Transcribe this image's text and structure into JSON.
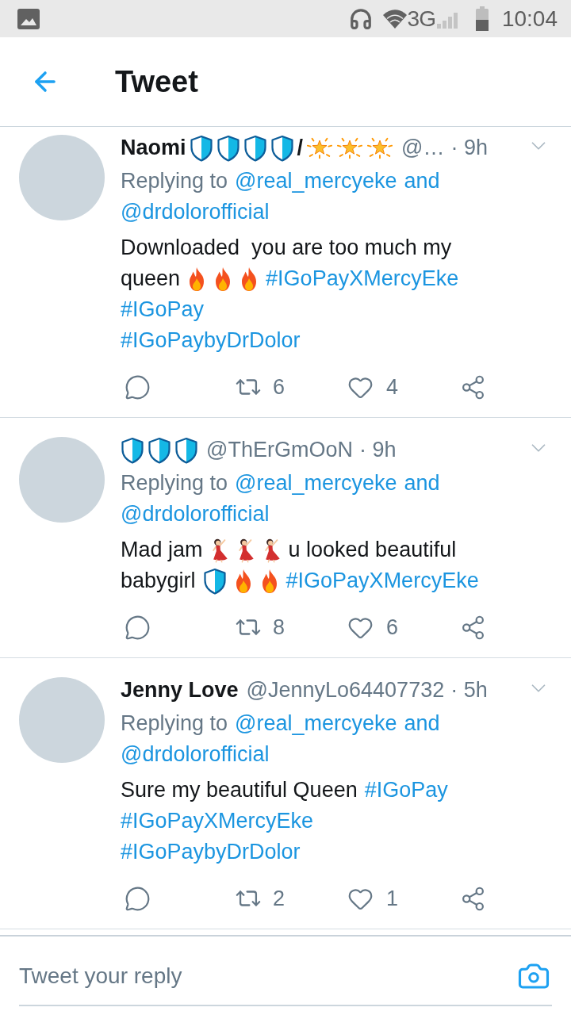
{
  "status_bar": {
    "network": "3G",
    "time": "10:04"
  },
  "header": {
    "title": "Tweet"
  },
  "tweets": [
    {
      "name": [
        {
          "kind": "text",
          "text": "Naomi"
        },
        {
          "kind": "shield"
        },
        {
          "kind": "shield"
        },
        {
          "kind": "shield"
        },
        {
          "kind": "shield"
        },
        {
          "kind": "text",
          "text": "/"
        },
        {
          "kind": "star"
        },
        {
          "kind": "star"
        },
        {
          "kind": "star"
        }
      ],
      "handle": "@…",
      "time": "· 9h",
      "reply_to": [
        [
          {
            "kind": "text",
            "text": "Replying to"
          },
          {
            "kind": "mention",
            "text": "@real_mercyeke"
          },
          {
            "kind": "accent",
            "text": "and"
          }
        ],
        [
          {
            "kind": "mention",
            "text": "@drdolorofficial"
          }
        ]
      ],
      "body": [
        [
          {
            "kind": "text",
            "text": "Downloaded  you are too much my"
          }
        ],
        [
          {
            "kind": "text",
            "text": "queen"
          },
          {
            "kind": "fire"
          },
          {
            "kind": "fire"
          },
          {
            "kind": "fire"
          },
          {
            "kind": "hashtag",
            "text": "#IGoPayXMercyEke"
          }
        ],
        [
          {
            "kind": "hashtag",
            "text": "#IGoPay"
          }
        ],
        [
          {
            "kind": "hashtag",
            "text": "#IGoPaybyDrDolor"
          }
        ]
      ],
      "retweets": "6",
      "likes": "4"
    },
    {
      "name": [
        {
          "kind": "shield"
        },
        {
          "kind": "shield"
        },
        {
          "kind": "shield"
        }
      ],
      "handle": "@ThErGmOoN",
      "time": "· 9h",
      "reply_to": [
        [
          {
            "kind": "text",
            "text": "Replying to"
          },
          {
            "kind": "mention",
            "text": "@real_mercyeke"
          },
          {
            "kind": "accent",
            "text": "and"
          }
        ],
        [
          {
            "kind": "mention",
            "text": "@drdolorofficial"
          }
        ]
      ],
      "body": [
        [
          {
            "kind": "text",
            "text": "Mad jam"
          },
          {
            "kind": "dancer"
          },
          {
            "kind": "dancer"
          },
          {
            "kind": "dancer"
          },
          {
            "kind": "text",
            "text": "u looked beautiful"
          }
        ],
        [
          {
            "kind": "text",
            "text": "babygirl"
          },
          {
            "kind": "shield"
          },
          {
            "kind": "fire"
          },
          {
            "kind": "fire"
          },
          {
            "kind": "hashtag",
            "text": "#IGoPayXMercyEke"
          }
        ]
      ],
      "retweets": "8",
      "likes": "6"
    },
    {
      "name": [
        {
          "kind": "text",
          "text": "Jenny Love"
        }
      ],
      "handle": "@JennyLo64407732",
      "time": "· 5h",
      "reply_to": [
        [
          {
            "kind": "text",
            "text": "Replying to"
          },
          {
            "kind": "mention",
            "text": "@real_mercyeke"
          },
          {
            "kind": "accent",
            "text": "and"
          }
        ],
        [
          {
            "kind": "mention",
            "text": "@drdolorofficial"
          }
        ]
      ],
      "body": [
        [
          {
            "kind": "text",
            "text": "Sure my beautiful Queen"
          },
          {
            "kind": "hashtag",
            "text": "#IGoPay"
          }
        ],
        [
          {
            "kind": "hashtag",
            "text": "#IGoPayXMercyEke"
          }
        ],
        [
          {
            "kind": "hashtag",
            "text": "#IGoPaybyDrDolor"
          }
        ]
      ],
      "retweets": "2",
      "likes": "1"
    }
  ],
  "composer": {
    "placeholder": "Tweet your reply"
  }
}
